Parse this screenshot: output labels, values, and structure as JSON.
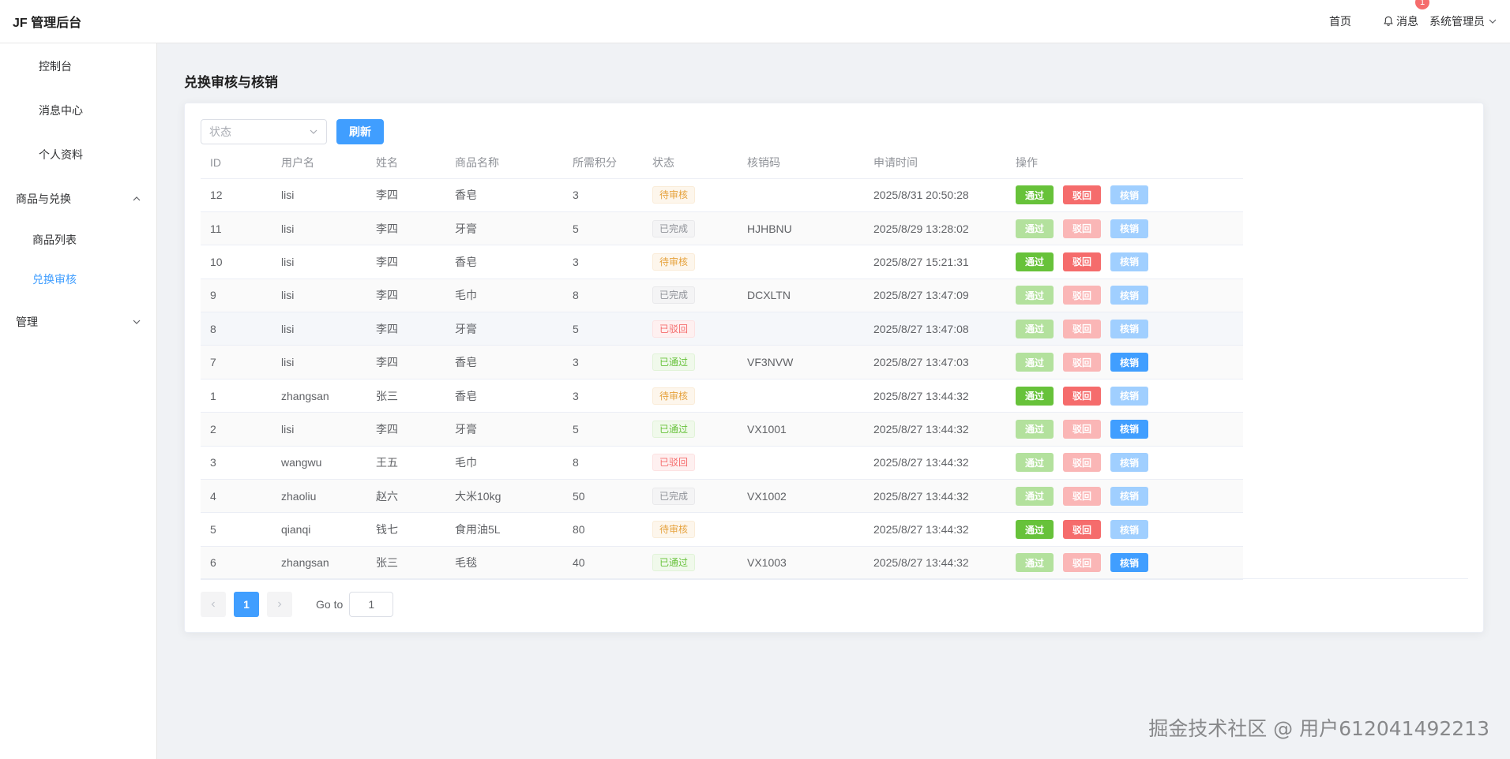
{
  "header": {
    "brand": "JF 管理后台",
    "home": "首页",
    "messages": "消息",
    "message_count": "1",
    "user": "系统管理员"
  },
  "sidebar": {
    "items": [
      {
        "label": "控制台"
      },
      {
        "label": "消息中心"
      },
      {
        "label": "个人资料"
      },
      {
        "label": "商品与兑换"
      },
      {
        "label": "商品列表"
      },
      {
        "label": "兑换审核"
      },
      {
        "label": "管理"
      }
    ]
  },
  "page": {
    "title": "兑换审核与核销",
    "status_placeholder": "状态",
    "refresh": "刷新"
  },
  "table": {
    "headers": [
      "ID",
      "用户名",
      "姓名",
      "商品名称",
      "所需积分",
      "状态",
      "核销码",
      "申请时间",
      "操作"
    ],
    "op_labels": {
      "pass": "通过",
      "reject": "驳回",
      "verify": "核销"
    },
    "rows": [
      {
        "id": "12",
        "username": "lisi",
        "name": "李四",
        "product": "香皂",
        "points": "3",
        "status": "待审核",
        "code": "",
        "time": "2025/8/31 20:50:28"
      },
      {
        "id": "11",
        "username": "lisi",
        "name": "李四",
        "product": "牙膏",
        "points": "5",
        "status": "已完成",
        "code": "HJHBNU",
        "time": "2025/8/29 13:28:02"
      },
      {
        "id": "10",
        "username": "lisi",
        "name": "李四",
        "product": "香皂",
        "points": "3",
        "status": "待审核",
        "code": "",
        "time": "2025/8/27 15:21:31"
      },
      {
        "id": "9",
        "username": "lisi",
        "name": "李四",
        "product": "毛巾",
        "points": "8",
        "status": "已完成",
        "code": "DCXLTN",
        "time": "2025/8/27 13:47:09"
      },
      {
        "id": "8",
        "username": "lisi",
        "name": "李四",
        "product": "牙膏",
        "points": "5",
        "status": "已驳回",
        "code": "",
        "time": "2025/8/27 13:47:08"
      },
      {
        "id": "7",
        "username": "lisi",
        "name": "李四",
        "product": "香皂",
        "points": "3",
        "status": "已通过",
        "code": "VF3NVW",
        "time": "2025/8/27 13:47:03"
      },
      {
        "id": "1",
        "username": "zhangsan",
        "name": "张三",
        "product": "香皂",
        "points": "3",
        "status": "待审核",
        "code": "",
        "time": "2025/8/27 13:44:32"
      },
      {
        "id": "2",
        "username": "lisi",
        "name": "李四",
        "product": "牙膏",
        "points": "5",
        "status": "已通过",
        "code": "VX1001",
        "time": "2025/8/27 13:44:32"
      },
      {
        "id": "3",
        "username": "wangwu",
        "name": "王五",
        "product": "毛巾",
        "points": "8",
        "status": "已驳回",
        "code": "",
        "time": "2025/8/27 13:44:32"
      },
      {
        "id": "4",
        "username": "zhaoliu",
        "name": "赵六",
        "product": "大米10kg",
        "points": "50",
        "status": "已完成",
        "code": "VX1002",
        "time": "2025/8/27 13:44:32"
      },
      {
        "id": "5",
        "username": "qianqi",
        "name": "钱七",
        "product": "食用油5L",
        "points": "80",
        "status": "待审核",
        "code": "",
        "time": "2025/8/27 13:44:32"
      },
      {
        "id": "6",
        "username": "zhangsan",
        "name": "张三",
        "product": "毛毯",
        "points": "40",
        "status": "已通过",
        "code": "VX1003",
        "time": "2025/8/27 13:44:32"
      }
    ]
  },
  "pagination": {
    "current": "1",
    "goto_label": "Go to",
    "goto_value": "1"
  },
  "watermark": "掘金技术社区 @ 用户612041492213",
  "colors": {
    "primary": "#409eff",
    "success": "#67c23a",
    "danger": "#f56c6c",
    "warning": "#e6a23c"
  }
}
